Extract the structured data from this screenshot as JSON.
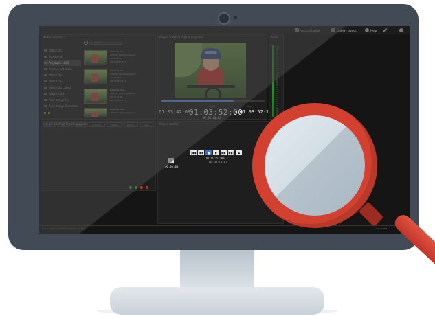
{
  "app": {
    "topbar": {
      "buttons": [
        {
          "label": "Vertical layout",
          "icon": "layout-icon"
        },
        {
          "label": "Display layout",
          "icon": "display-icon"
        },
        {
          "label": "Help",
          "icon": "help-icon"
        },
        {
          "label": "",
          "icon": "wrench-icon"
        },
        {
          "label": "",
          "icon": "globe-icon"
        }
      ]
    },
    "panels": {
      "browser_title": "Media browser",
      "viewer_title": "Player 1080i50 Digital playback",
      "meters_title": "Audio",
      "clips_title": "Clip list 1080i50 Digital playback",
      "control_title": "Player control"
    },
    "browser": {
      "search_placeholder": "Search",
      "items": [
        {
          "label": "Watch 1a"
        },
        {
          "label": "Stockshot"
        },
        {
          "label": "Playback 1080i"
        },
        {
          "label": "Archive playback"
        },
        {
          "label": "Watch 1b"
        },
        {
          "label": "Watch 2a"
        },
        {
          "label": "Watch 2b Latest"
        },
        {
          "label": "Watch clips"
        },
        {
          "label": "Avid image 1a"
        },
        {
          "label": "Avid image 2b render"
        }
      ],
      "selected_index": 2,
      "clips": [
        {
          "name": "Watch1a.mov",
          "format": "1080i50 Digital playback",
          "duration": "00:00:12:15",
          "codec": "XDCAM HD 422"
        },
        {
          "name": "Watch1b.mov",
          "format": "1080i50 Digital playback",
          "duration": "00:00:08:03",
          "codec": "XDCAM HD 422"
        },
        {
          "name": "Watch2a.mov",
          "format": "1080i50 Digital playback",
          "duration": "00:00:09:20",
          "codec": "XDCAM HD 422"
        },
        {
          "name": "Watch2b.mov",
          "format": "1080i50 Digital playback",
          "duration": "",
          "codec": ""
        }
      ]
    },
    "viewer": {
      "timecode_in_label": "In",
      "timecode_current_label": "Current",
      "timecode_out_label": "Out",
      "timecode_in": "01:03:42:09",
      "timecode_current": "01:03:52:00",
      "timecode_out": "01:03:52:11",
      "duration": "00:00:10:02"
    },
    "clip_table": {
      "columns": [
        "#",
        "ID",
        "Name",
        "Duration",
        "Status",
        "Device",
        "Date"
      ]
    },
    "player_control": {
      "buttons": [
        {
          "label": "|◀◀"
        },
        {
          "label": "◀◀"
        },
        {
          "label": "■"
        },
        {
          "label": "▶"
        },
        {
          "label": "▶▶"
        },
        {
          "label": "▶▶|"
        },
        {
          "label": "⏏"
        }
      ],
      "active_index": 2,
      "timecode": "01:03:52:00",
      "timecode_sub": "00:00:10:02",
      "small_label": "B",
      "small_timecode": "00:00:00"
    },
    "status": {
      "left": "Device: Playback 1080i50 Digital playback",
      "right": "Connected"
    },
    "colors": {
      "bezel": "#414a55",
      "screen_bg": "#151515",
      "accent": "#3c6fd1",
      "magnifier_ring": "#d4402f",
      "status_green": "#3db13d",
      "status_red": "#c0392b"
    }
  }
}
